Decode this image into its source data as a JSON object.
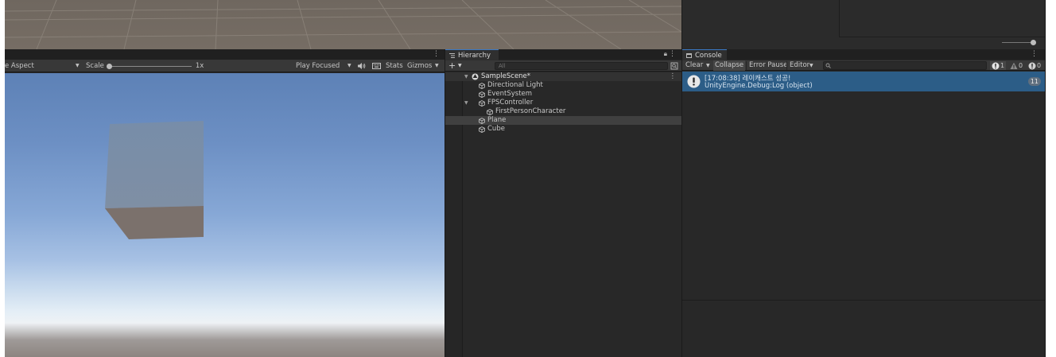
{
  "game_view": {
    "aspect_label": "e Aspect",
    "scale_label": "Scale",
    "scale_value": "1x",
    "play_mode_label": "Play Focused",
    "stats_label": "Stats",
    "gizmos_label": "Gizmos",
    "menu_glyph": "⋮"
  },
  "hierarchy": {
    "tab_label": "Hierarchy",
    "add_label": "+",
    "search_placeholder": "All",
    "menu_glyph": "⋮",
    "lock_glyph": "🔒",
    "scene": {
      "name": "SampleScene*",
      "children": [
        {
          "name": "Directional Light",
          "depth": 1,
          "has_children": false,
          "selected": false
        },
        {
          "name": "EventSystem",
          "depth": 1,
          "has_children": false,
          "selected": false
        },
        {
          "name": "FPSController",
          "depth": 1,
          "has_children": true,
          "selected": false
        },
        {
          "name": "FirstPersonCharacter",
          "depth": 2,
          "has_children": false,
          "selected": false
        },
        {
          "name": "Plane",
          "depth": 1,
          "has_children": false,
          "selected": true
        },
        {
          "name": "Cube",
          "depth": 1,
          "has_children": false,
          "selected": false
        }
      ]
    }
  },
  "console": {
    "tab_label": "Console",
    "menu_glyph": "⋮",
    "clear_label": "Clear",
    "collapse_label": "Collapse",
    "error_pause_label": "Error Pause",
    "editor_label": "Editor",
    "info_count": "1",
    "warning_count": "0",
    "error_count": "0",
    "entries": [
      {
        "line1": "[17:08:38] 레이캐스트 성공!",
        "line2": "UnityEngine.Debug:Log (object)",
        "count": "11",
        "icon": "info-icon"
      }
    ]
  },
  "colors": {
    "selection_blue": "#2c5d87",
    "panel_bg": "#282828",
    "toolbar_bg": "#383838",
    "sky_top": "#5d81b6",
    "cube_top": "#6f869f",
    "cube_bottom": "#7a706b"
  }
}
